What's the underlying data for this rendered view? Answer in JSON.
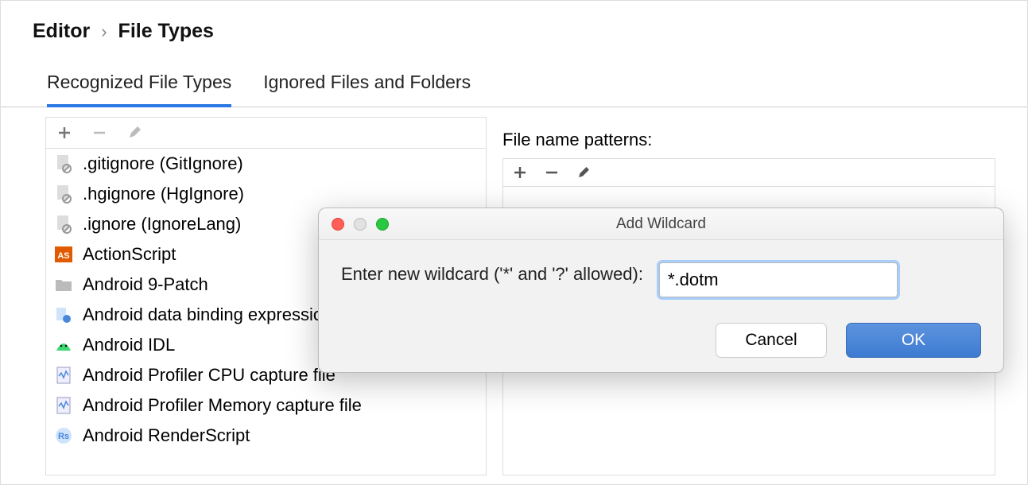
{
  "breadcrumb": {
    "first": "Editor",
    "second": "File Types"
  },
  "tabs": [
    {
      "label": "Recognized File Types",
      "active": true
    },
    {
      "label": "Ignored Files and Folders",
      "active": false
    }
  ],
  "filetypes": [
    {
      "icon": "file-ignore",
      "label": ".gitignore (GitIgnore)"
    },
    {
      "icon": "file-ignore",
      "label": ".hgignore (HgIgnore)"
    },
    {
      "icon": "file-ignore",
      "label": ".ignore (IgnoreLang)"
    },
    {
      "icon": "as",
      "label": "ActionScript"
    },
    {
      "icon": "folder",
      "label": "Android 9-Patch"
    },
    {
      "icon": "binding",
      "label": "Android data binding expression file"
    },
    {
      "icon": "android",
      "label": "Android IDL"
    },
    {
      "icon": "profiler",
      "label": "Android Profiler CPU capture file"
    },
    {
      "icon": "profiler",
      "label": "Android Profiler Memory capture file"
    },
    {
      "icon": "rs",
      "label": "Android RenderScript"
    }
  ],
  "patterns": {
    "label": "File name patterns:"
  },
  "dialog": {
    "title": "Add Wildcard",
    "prompt": "Enter new wildcard ('*' and '?' allowed):",
    "value": "*.dotm",
    "cancel": "Cancel",
    "ok": "OK"
  }
}
